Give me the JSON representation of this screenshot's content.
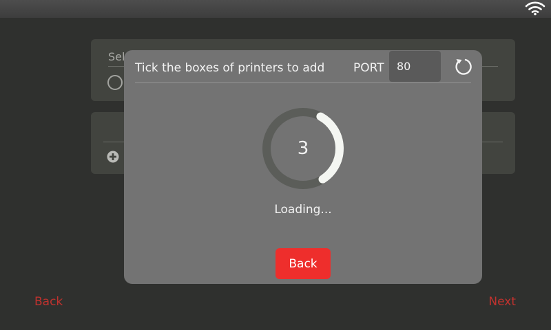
{
  "status_bar": {
    "wifi_icon": "wifi-icon"
  },
  "background": {
    "card1_label": "Sel",
    "back_label": "Back",
    "next_label": "Next"
  },
  "dialog": {
    "title": "Tick the boxes of printers to add",
    "port_label": "PORT",
    "port_value": "80",
    "refresh_icon": "refresh-icon",
    "countdown": "3",
    "progress": 0.33,
    "loading_text": "Loading...",
    "back_label": "Back"
  },
  "colors": {
    "accent": "#ee2e2c",
    "nav_text": "#c0322e",
    "dialog_bg": "#737373",
    "page_bg": "#2f302e"
  }
}
